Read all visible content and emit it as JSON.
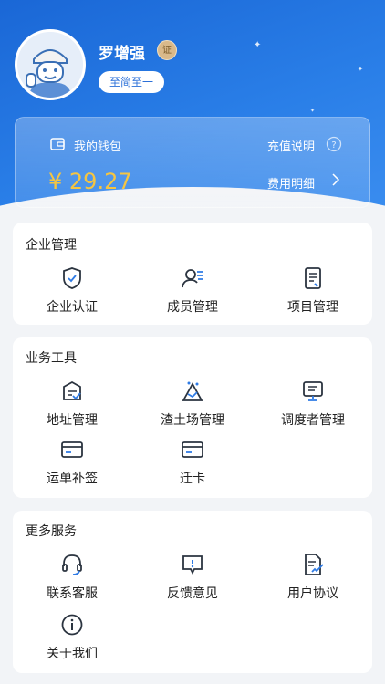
{
  "profile": {
    "name": "罗增强",
    "cert_badge": "证",
    "company": "至简至一"
  },
  "wallet": {
    "label": "我的钱包",
    "recharge_label": "充值说明",
    "balance": "¥ 29.27",
    "detail_label": "费用明细"
  },
  "sections": {
    "enterprise": {
      "title": "企业管理",
      "items": [
        "企业认证",
        "成员管理",
        "项目管理"
      ]
    },
    "business": {
      "title": "业务工具",
      "items": [
        "地址管理",
        "渣土场管理",
        "调度者管理",
        "运单补签",
        "迁卡"
      ]
    },
    "more": {
      "title": "更多服务",
      "items": [
        "联系客服",
        "反馈意见",
        "用户协议",
        "关于我们"
      ]
    }
  },
  "colors": {
    "header_blue": "#2a7fe8",
    "balance_gold": "#f5c542",
    "icon_dark": "#2b3440",
    "icon_accent": "#2f7be5"
  }
}
